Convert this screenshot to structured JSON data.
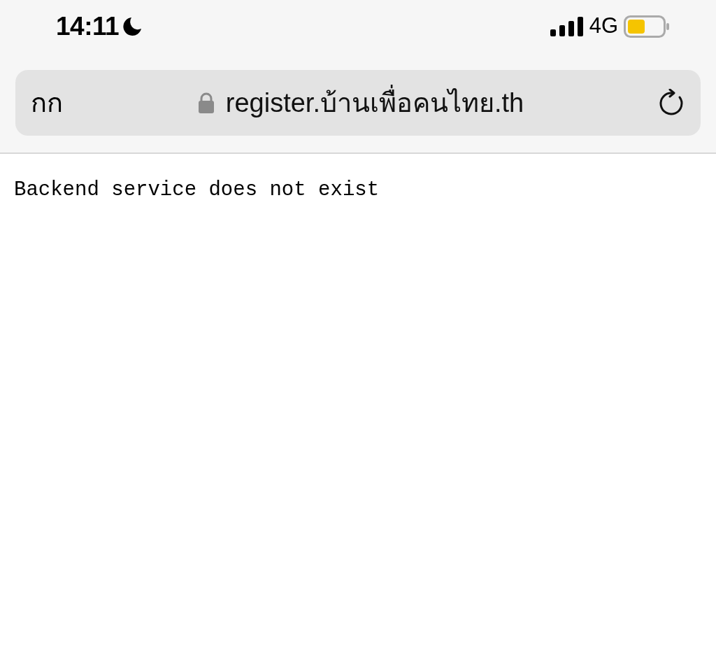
{
  "status_bar": {
    "time": "14:11",
    "network": "4G"
  },
  "address_bar": {
    "text_size_button": "กก",
    "url": "register.บ้านเพื่อคนไทย.th"
  },
  "page": {
    "message": "Backend service does not exist"
  }
}
